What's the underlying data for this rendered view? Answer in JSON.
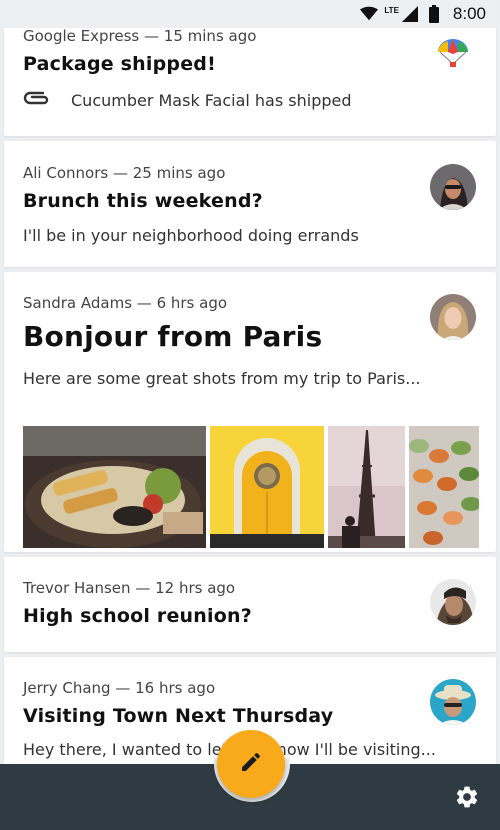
{
  "status_bar": {
    "time": "8:00",
    "network_label": "LTE"
  },
  "emails": [
    {
      "sender": "Google Express",
      "time_ago": "15 mins ago",
      "subject": "Package shipped!",
      "preview": "Cucumber Mask Facial has shipped",
      "avatar_icon": "parachute-icon"
    },
    {
      "sender": "Ali Connors",
      "time_ago": "25 mins ago",
      "subject": "Brunch this weekend?",
      "preview": "I'll be in your neighborhood doing errands",
      "avatar_icon": "avatar-ali-connors"
    },
    {
      "sender": "Sandra Adams",
      "time_ago": "6 hrs ago",
      "subject": "Bonjour from Paris",
      "preview": "Here are some great shots from my trip to Paris...",
      "avatar_icon": "avatar-sandra-adams",
      "photos": [
        "food-plate-photo",
        "yellow-door-photo",
        "eiffel-tower-photo",
        "macarons-photo"
      ]
    },
    {
      "sender": "Trevor Hansen",
      "time_ago": "12 hrs ago",
      "subject": "High school reunion?",
      "avatar_icon": "avatar-trevor-hansen"
    },
    {
      "sender": "Jerry Chang",
      "time_ago": "16 hrs ago",
      "subject": "Visiting Town Next Thursday",
      "preview": "Hey there, I wanted to let you know I'll be visiting...",
      "avatar_icon": "avatar-jerry-chang"
    }
  ],
  "meta_separator": " — ",
  "bottom_bar": {
    "fab_icon": "pencil-icon",
    "settings_icon": "gear-icon"
  },
  "colors": {
    "accent": "#f9aa1b",
    "bottom_bar": "#2f3b42",
    "background": "#eceff1"
  }
}
